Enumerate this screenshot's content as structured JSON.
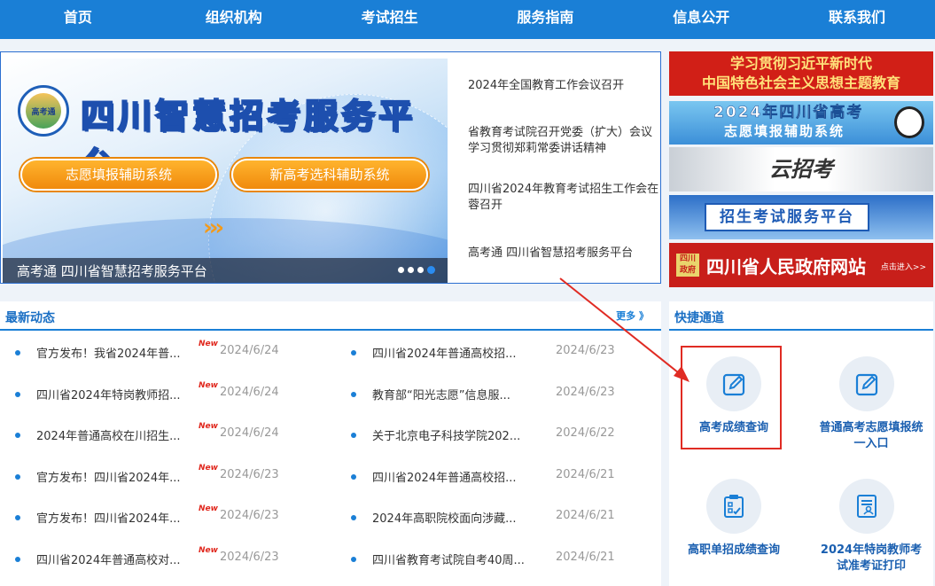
{
  "nav": [
    "首页",
    "组织机构",
    "考试招生",
    "服务指南",
    "信息公开",
    "联系我们"
  ],
  "banner": {
    "seal_text": "高考通",
    "title": "四川智慧招考服务平台",
    "button_1": "志愿填报辅助系统",
    "button_2": "新高考选科辅助系统",
    "arrows": "›››",
    "caption": "高考通 四川省智慧招考服务平台",
    "news": [
      "2024年全国教育工作会议召开",
      "省教育考试院召开党委（扩大）会议学习贯彻郑莉常委讲话精神",
      "四川省2024年教育考试招生工作会在蓉召开",
      "高考通 四川省智慧招考服务平台"
    ]
  },
  "side_banners": {
    "b1_line1": "学习贯彻习近平新时代",
    "b1_line2": "中国特色社会主义思想主题教育",
    "b2_line1": "2024年四川省高考",
    "b2_line2": "志愿填报辅助系统",
    "b3": "云招考",
    "b4": "招生考试服务平台",
    "b5_emblem": "四川 政府",
    "b5": "四川省人民政府网站",
    "b5_enter": "点击进入>>"
  },
  "news_panel": {
    "title": "最新动态",
    "more": "更多 》",
    "new_tag": "New",
    "left": [
      {
        "title": "官方发布！我省2024年普...",
        "date": "2024/6/24",
        "new": true
      },
      {
        "title": "四川省2024年特岗教师招...",
        "date": "2024/6/24",
        "new": true
      },
      {
        "title": "2024年普通高校在川招生...",
        "date": "2024/6/24",
        "new": true
      },
      {
        "title": "官方发布！四川省2024年...",
        "date": "2024/6/23",
        "new": true
      },
      {
        "title": "官方发布！四川省2024年...",
        "date": "2024/6/23",
        "new": true
      },
      {
        "title": "四川省2024年普通高校对...",
        "date": "2024/6/23",
        "new": true
      }
    ],
    "right": [
      {
        "title": "四川省2024年普通高校招...",
        "date": "2024/6/23"
      },
      {
        "title": "教育部“阳光志愿”信息服...",
        "date": "2024/6/23"
      },
      {
        "title": "关于北京电子科技学院202...",
        "date": "2024/6/22"
      },
      {
        "title": "四川省2024年普通高校招...",
        "date": "2024/6/21"
      },
      {
        "title": "2024年高职院校面向涉藏...",
        "date": "2024/6/21"
      },
      {
        "title": "四川省教育考试院自考40周...",
        "date": "2024/6/21"
      }
    ]
  },
  "quick_panel": {
    "title": "快捷通道",
    "items": [
      {
        "label": "高考成绩查询",
        "icon": "edit-icon"
      },
      {
        "label": "普通高考志愿填报统一入口",
        "icon": "edit-icon"
      },
      {
        "label": "高职单招成绩查询",
        "icon": "clipboard-check-icon"
      },
      {
        "label": "2024年特岗教师考试准考证打印",
        "icon": "id-card-icon"
      }
    ]
  },
  "colors": {
    "nav": "#1a7fd6",
    "accent_red": "#e02b23",
    "new_tag": "#e0281e"
  }
}
